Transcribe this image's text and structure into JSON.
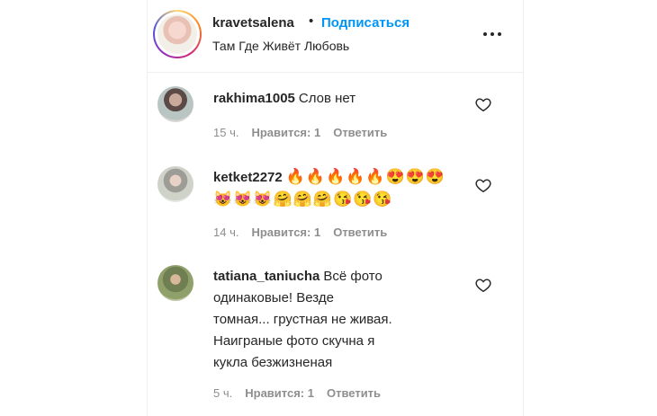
{
  "header": {
    "username": "kravetsalena",
    "separator": "•",
    "follow_label": "Подписаться",
    "location": "Там Где Живёт Любовь",
    "more_icon": "more-horizontal-icon"
  },
  "comments": [
    {
      "username": "rakhima1005",
      "text": "Слов нет",
      "time": "15 ч.",
      "likes": "Нравится: 1",
      "reply": "Ответить"
    },
    {
      "username": "ketket2272",
      "text": "🔥🔥🔥🔥🔥😍😍😍",
      "text2": "😻😻😻🤗🤗🤗😘😘😘",
      "time": "14 ч.",
      "likes": "Нравится: 1",
      "reply": "Ответить"
    },
    {
      "username": "tatiana_taniucha",
      "text": "Всё фото одинаковые! Везде томная... грустная не живая. Наиграные фото скучна я кукла безжизненая",
      "time": "5 ч.",
      "likes": "Нравится: 1",
      "reply": "Ответить"
    }
  ],
  "colors": {
    "accent": "#0095f6",
    "text": "#262626",
    "meta": "#8e8e8e",
    "divider": "#efefef"
  }
}
